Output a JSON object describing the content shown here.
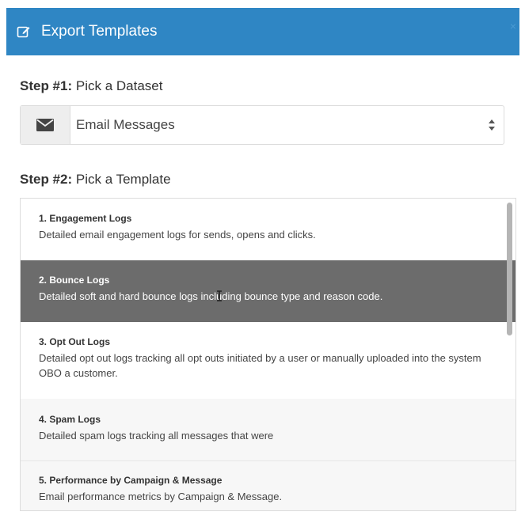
{
  "dialog": {
    "title": "Export Templates",
    "close_label": "×"
  },
  "step1": {
    "label": "Step #1:",
    "text": "Pick a Dataset",
    "selected_value": "Email Messages"
  },
  "step2": {
    "label": "Step #2:",
    "text": "Pick a Template"
  },
  "templates": [
    {
      "title": "1. Engagement Logs",
      "desc": "Detailed email engagement logs for sends, opens and clicks."
    },
    {
      "title": "2. Bounce Logs",
      "desc": "Detailed soft and hard bounce logs including bounce type and reason code."
    },
    {
      "title": "3. Opt Out Logs",
      "desc": "Detailed opt out logs tracking all opt outs initiated by a user or manually uploaded into the system OBO a customer."
    },
    {
      "title": "4. Spam Logs",
      "desc": "Detailed spam logs tracking all messages that were"
    },
    {
      "title": "5. Performance by Campaign & Message",
      "desc": "Email performance metrics by Campaign & Message."
    }
  ],
  "colors": {
    "header": "#2f86c4",
    "selected_row": "#6c6c6c"
  }
}
